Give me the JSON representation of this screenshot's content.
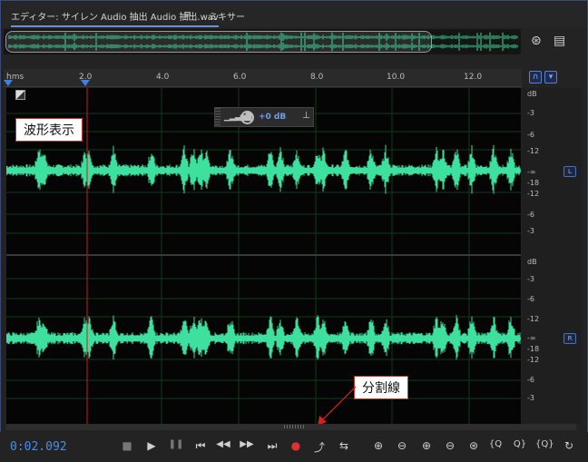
{
  "tabs": {
    "editor": "エディター: サイレン Audio 抽出 Audio 抽出.wav",
    "menu_glyph": "≡",
    "mixer": "ミキサー"
  },
  "ruler": {
    "unit_label": "hms",
    "ticks": [
      "2.0",
      "4.0",
      "6.0",
      "8.0",
      "10.0",
      "12.0"
    ]
  },
  "hud": {
    "bars_glyph": "▁▂▃▅▇",
    "volume": "+0 dB",
    "pin_glyph": "⊥"
  },
  "db_scale": {
    "unit": "dB",
    "top_channel": [
      "-3",
      "-6",
      "-12",
      "-∞",
      "-18",
      "-12",
      "-6",
      "-3"
    ],
    "bottom_channel": [
      "-3",
      "-6",
      "-12",
      "-∞",
      "-18",
      "-12",
      "-6",
      "-3"
    ],
    "left_badge": "L",
    "right_badge": "R"
  },
  "callouts": {
    "waveform": "波形表示",
    "divider": "分割線"
  },
  "transport": {
    "time": "0:02.092",
    "stop": "■",
    "play": "▶",
    "pause": "❚❚",
    "to_start": "⏮",
    "rewind": "◀◀",
    "forward": "▶▶",
    "to_end": "⏭",
    "record": "●",
    "loop": "⤴",
    "skip": "⇆"
  },
  "zoom_tools": [
    "⊕",
    "⊖",
    "⊕",
    "⊖",
    "⊛",
    "{Q",
    "Q}",
    "{Q}",
    "↻"
  ],
  "colors": {
    "waveform": "#3ee0a0",
    "accent": "#4b8ee8",
    "playhead": "#d02020",
    "callout_border": "#c0392b"
  }
}
